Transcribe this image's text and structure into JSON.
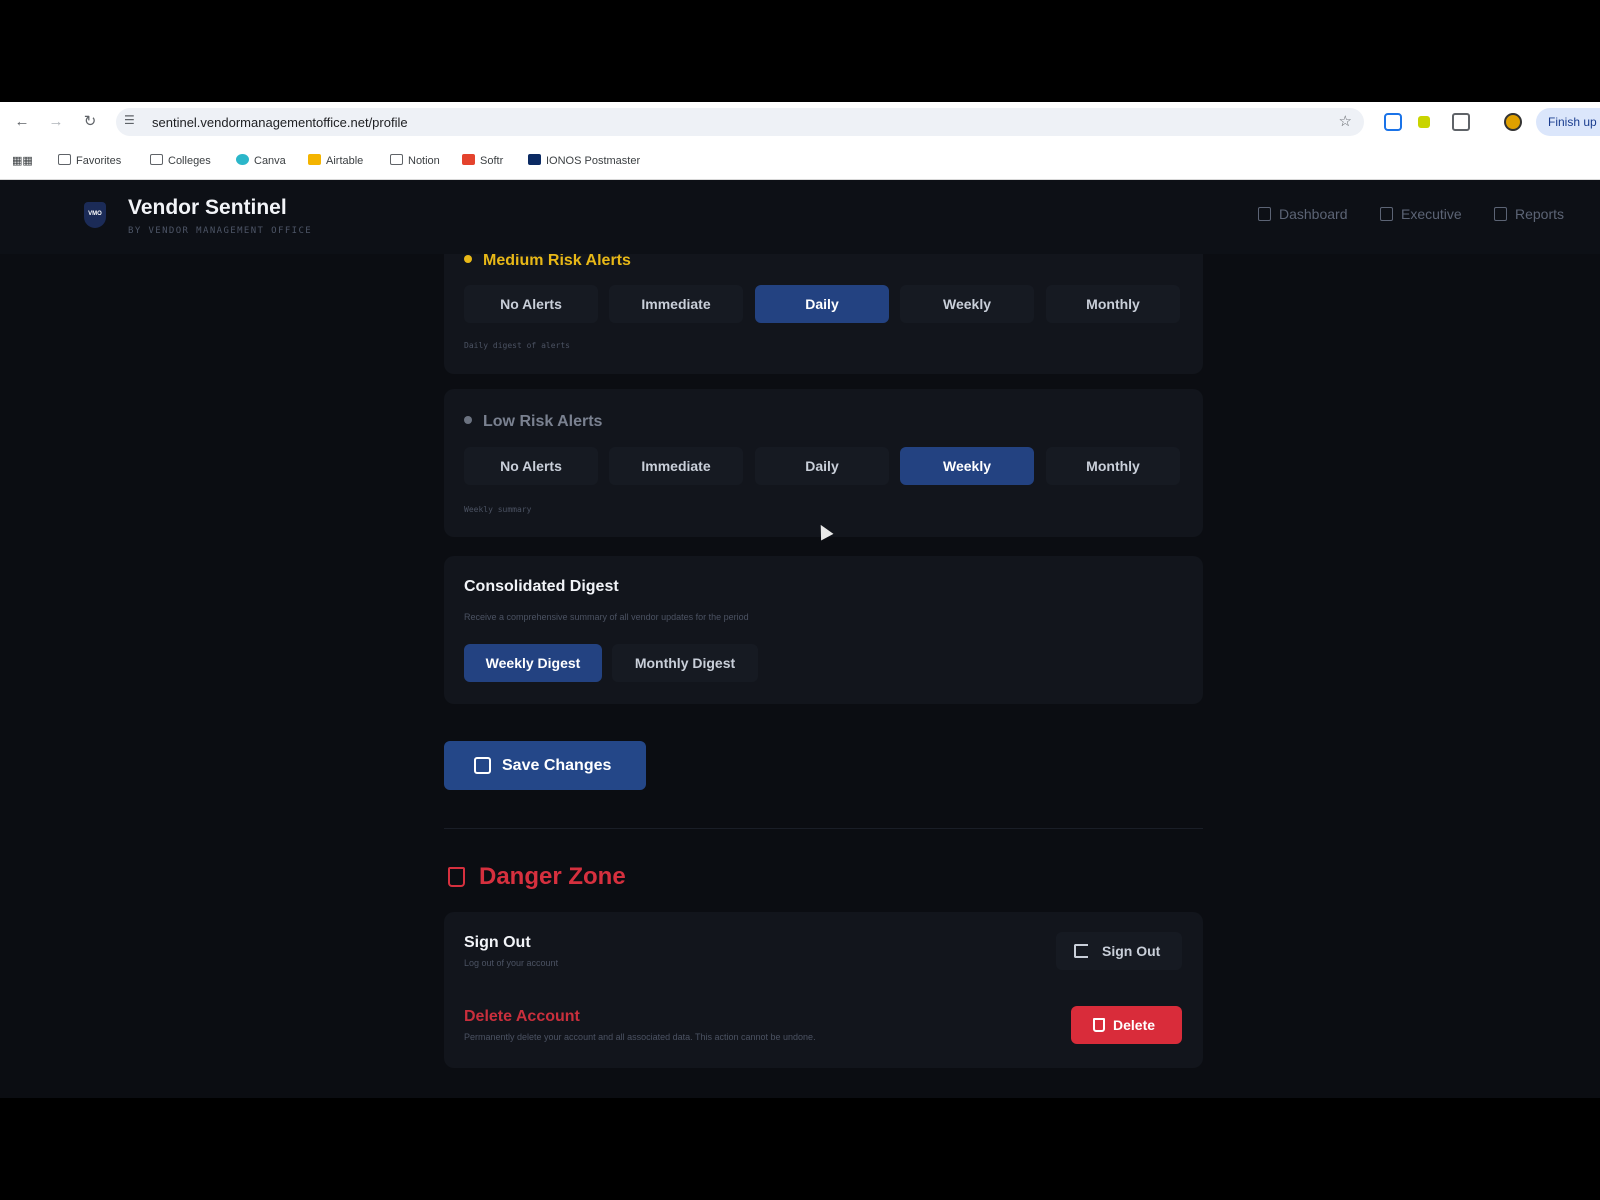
{
  "browser": {
    "url": "sentinel.vendormanagementoffice.net/profile",
    "finish_label": "Finish up",
    "bookmarks": [
      {
        "label": "Favorites",
        "icon": "folder-icon"
      },
      {
        "label": "Colleges",
        "icon": "folder-icon"
      },
      {
        "label": "Canva",
        "icon": "canva-icon"
      },
      {
        "label": "Airtable",
        "icon": "airtable-icon"
      },
      {
        "label": "Notion",
        "icon": "notion-icon"
      },
      {
        "label": "Softr",
        "icon": "softr-icon"
      },
      {
        "label": "IONOS Postmaster",
        "icon": "ionos-icon"
      }
    ]
  },
  "header": {
    "logo_text": "VMO",
    "title": "Vendor Sentinel",
    "subtitle": "BY VENDOR MANAGEMENT OFFICE",
    "nav": [
      {
        "label": "Dashboard",
        "icon": "dashboard-icon"
      },
      {
        "label": "Executive",
        "icon": "chart-icon"
      },
      {
        "label": "Reports",
        "icon": "document-icon"
      }
    ]
  },
  "medium_alerts": {
    "title": "Medium Risk Alerts",
    "accent": "#e8b817",
    "options": [
      "No Alerts",
      "Immediate",
      "Daily",
      "Weekly",
      "Monthly"
    ],
    "selected": "Daily",
    "hint": "Daily digest of alerts"
  },
  "low_alerts": {
    "title": "Low Risk Alerts",
    "accent": "#6b7280",
    "options": [
      "No Alerts",
      "Immediate",
      "Daily",
      "Weekly",
      "Monthly"
    ],
    "selected": "Weekly",
    "hint": "Weekly summary"
  },
  "digest": {
    "title": "Consolidated Digest",
    "description": "Receive a comprehensive summary of all vendor updates for the period",
    "options": [
      "Weekly Digest",
      "Monthly Digest"
    ],
    "selected": "Weekly Digest"
  },
  "save_label": "Save Changes",
  "danger": {
    "title": "Danger Zone",
    "accent": "#d6303e",
    "signout": {
      "title": "Sign Out",
      "description": "Log out of your account",
      "button": "Sign Out"
    },
    "delete": {
      "title": "Delete Account",
      "description": "Permanently delete your account and all associated data. This action cannot be undone.",
      "button": "Delete"
    }
  }
}
